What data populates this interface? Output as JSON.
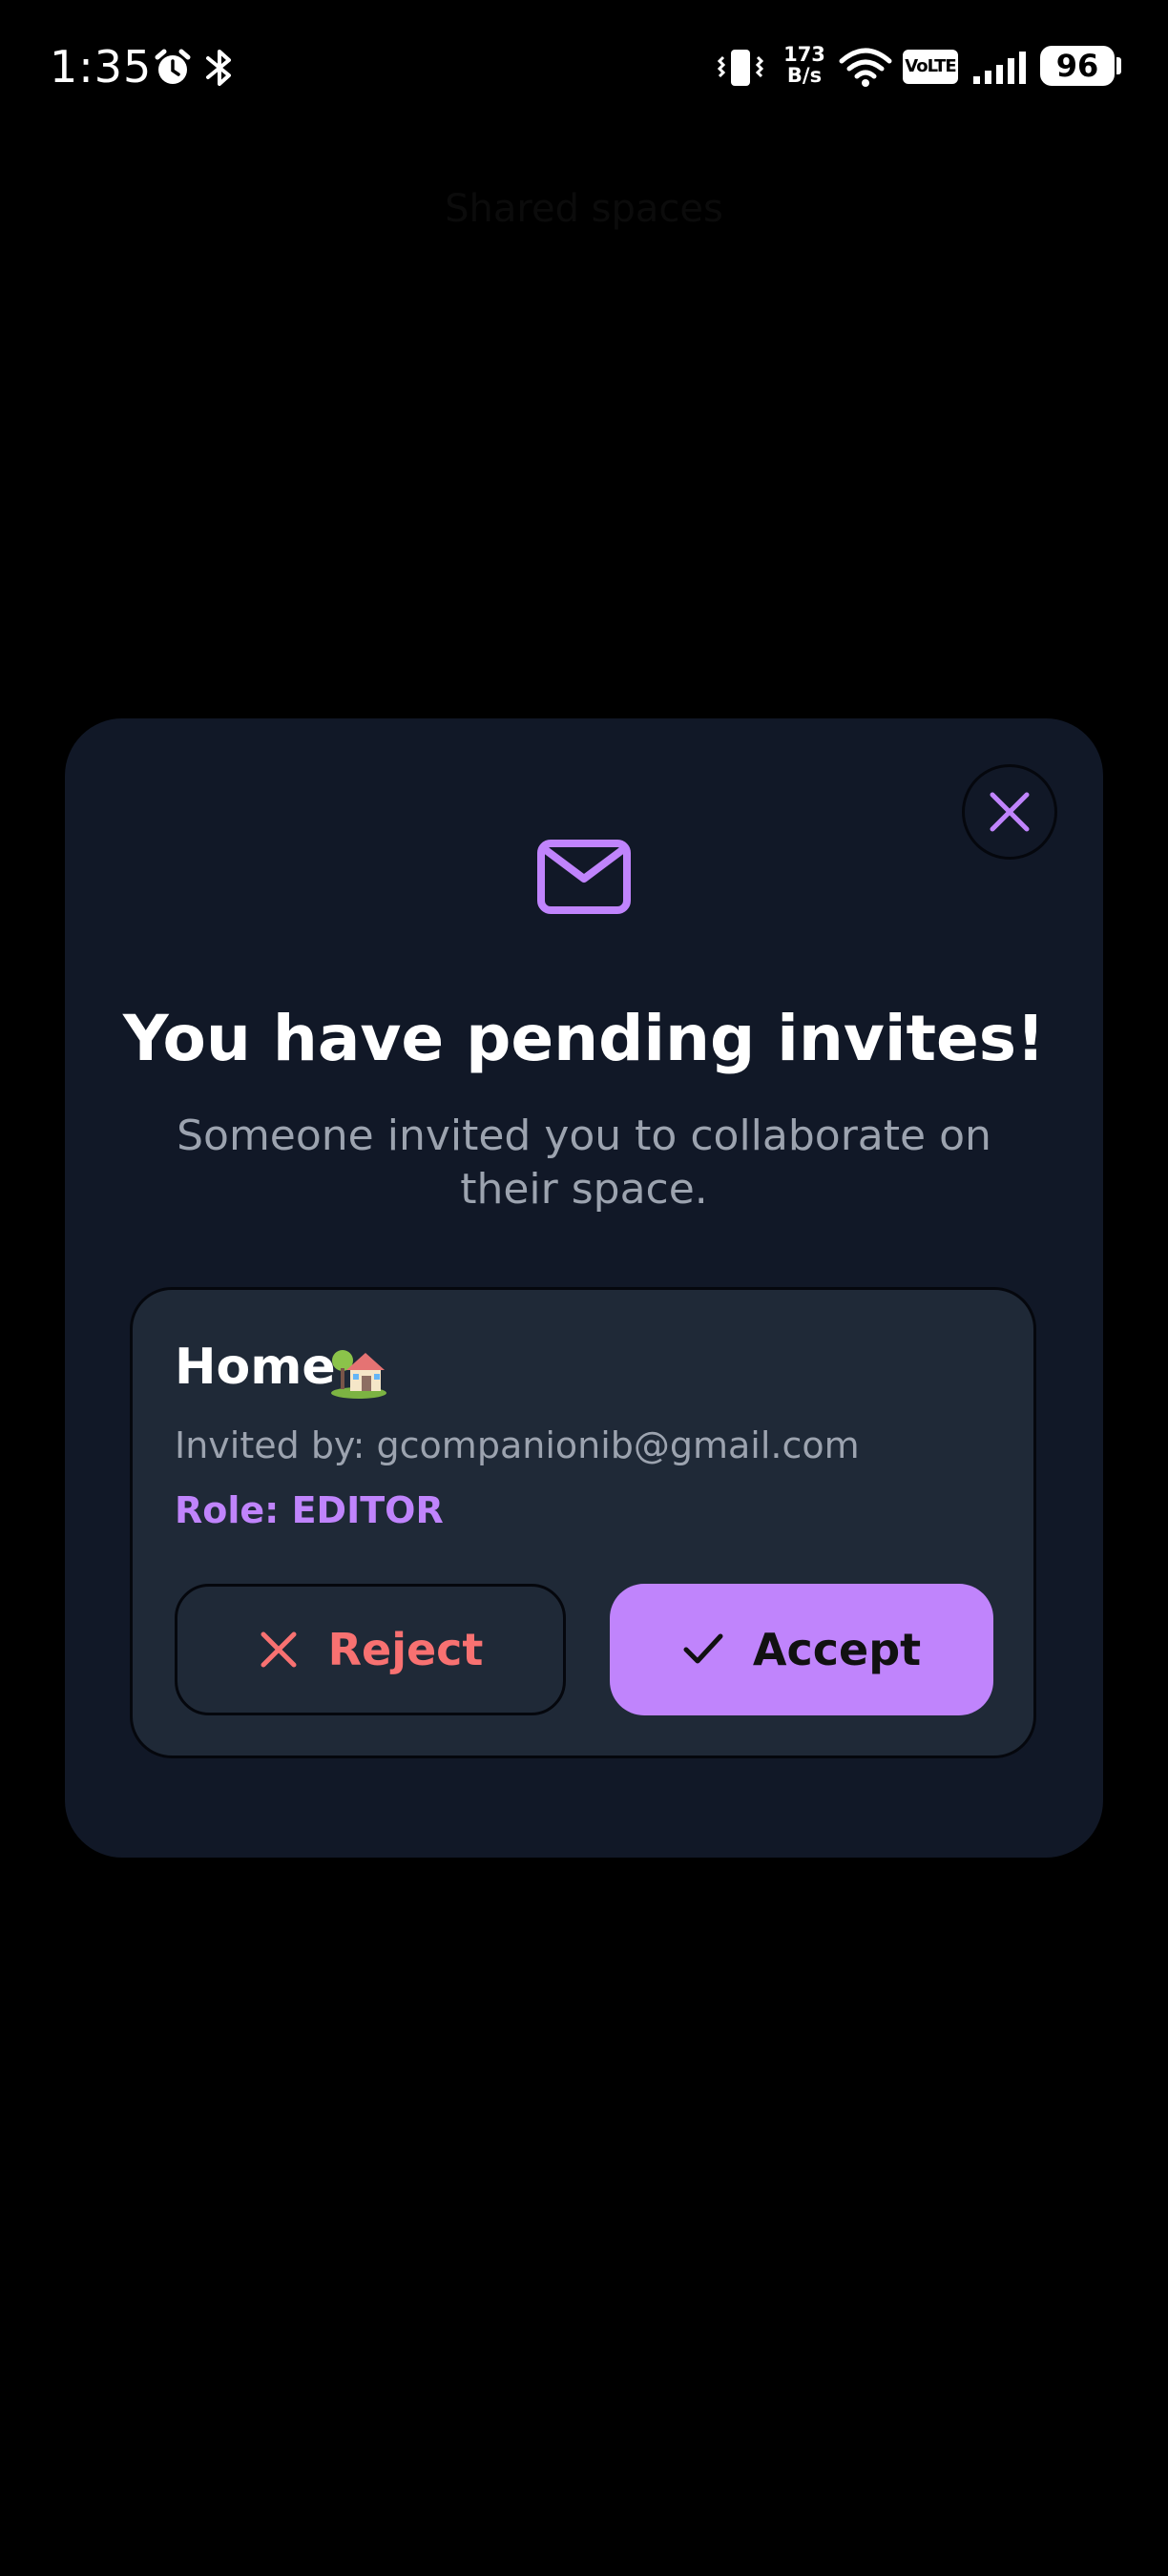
{
  "status_bar": {
    "time": "1:35",
    "net_speed": "173\nB/s",
    "volte": "VoLTE",
    "battery": "96"
  },
  "background": {
    "title": "Shared spaces"
  },
  "modal": {
    "title": "You have pending invites!",
    "subtitle": "Someone invited you to collaborate on their space.",
    "invite": {
      "space_name": "Home",
      "space_icon": "house-with-garden-emoji",
      "invited_by": "Invited by: gcompanionib@gmail.com",
      "role": "Role: EDITOR",
      "reject_label": "Reject",
      "accept_label": "Accept"
    }
  },
  "colors": {
    "background": "#000000",
    "modal_bg": "#111827",
    "card_bg": "#1f2937",
    "accent": "#c084fc",
    "reject": "#f87171",
    "muted_text": "#9ca3af"
  }
}
